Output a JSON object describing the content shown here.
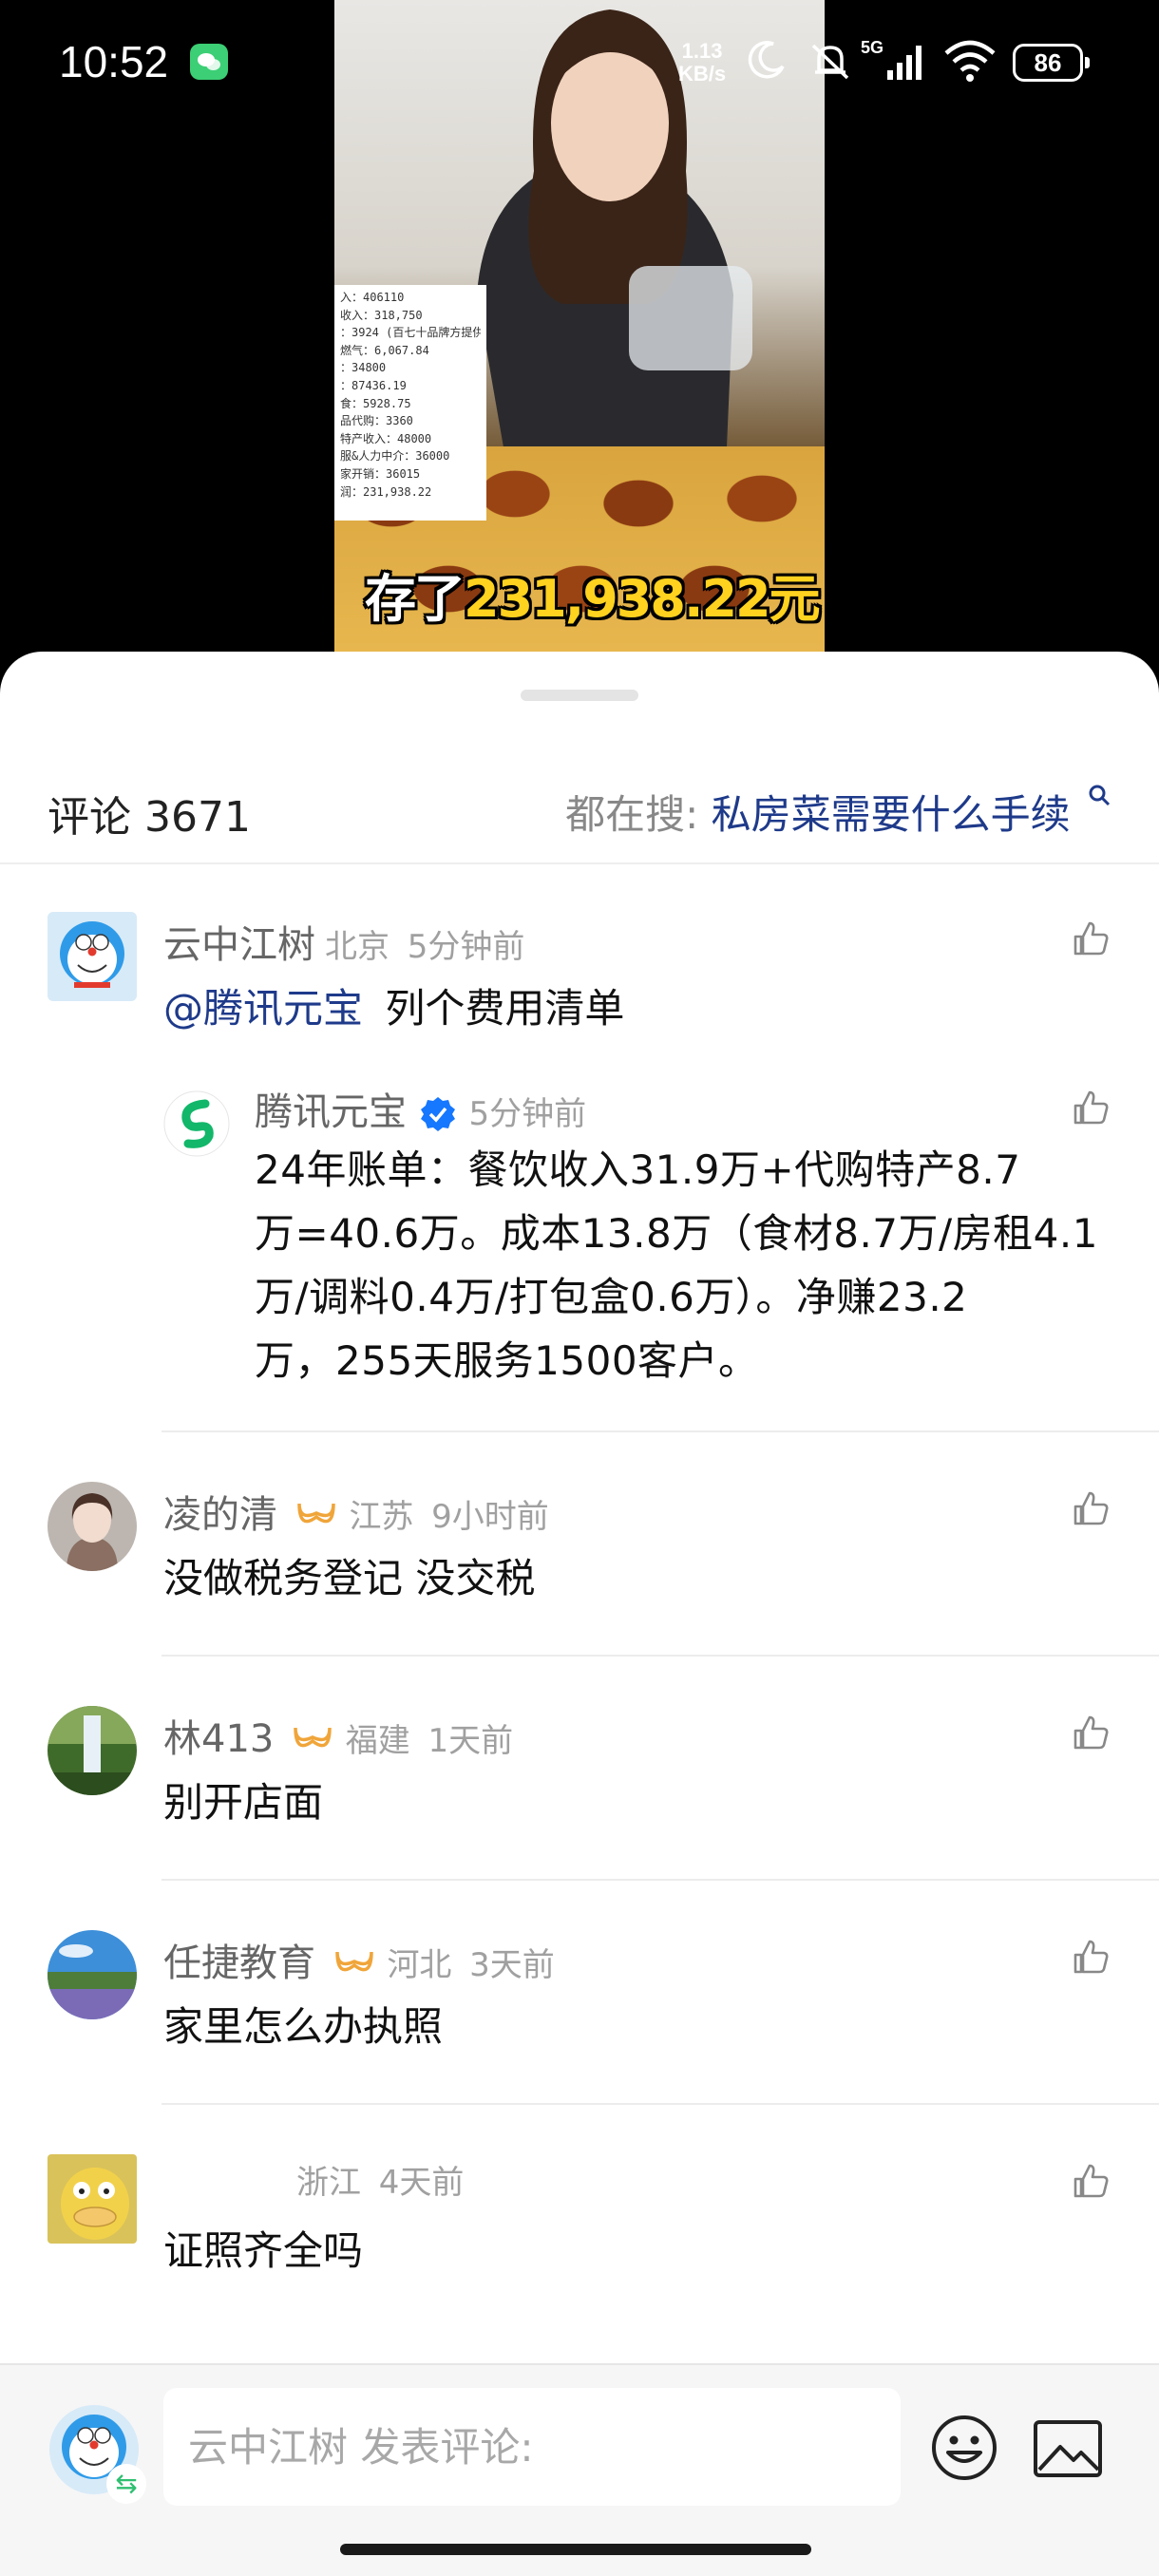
{
  "status_bar": {
    "time": "10:52",
    "net_speed_value": "1.13",
    "net_speed_unit": "KB/s",
    "network": "5G",
    "battery": "86"
  },
  "video": {
    "caption_prefix": "存了",
    "caption_amount": "231,938.22元",
    "receipt_lines": [
      "入：406110",
      "收入：318,750",
      "：3924 (百七十品牌方提供",
      "燃气：6,067.84",
      "：34800",
      "：87436.19",
      "食：5928.75",
      "品代购：3360",
      "特产收入：48000",
      "服&人力中介：36000",
      "家开销：36015",
      "润：231,938.22"
    ]
  },
  "sheet": {
    "title": "评论 3671",
    "search_prefix": "都在搜:",
    "search_term": "私房菜需要什么手续"
  },
  "comments": [
    {
      "name": "云中江树",
      "location": "北京",
      "time": "5分钟前",
      "mention": "@腾讯元宝",
      "text": "列个费用清单",
      "reply": {
        "name": "腾讯元宝",
        "time": "5分钟前",
        "lines": [
          "24年账单：餐饮收入31.9万+代购特产8.7",
          "万=40.6万。成本13.8万（食材8.7万/房租4.1",
          "万/调料0.4万/打包盒0.6万）。净赚23.2",
          "万，255天服务1500客户。"
        ]
      }
    },
    {
      "name": "凌的清",
      "location": "江苏",
      "time": "9小时前",
      "text": "没做税务登记 没交税"
    },
    {
      "name": "林413",
      "location": "福建",
      "time": "1天前",
      "text": "别开店面"
    },
    {
      "name": "任捷教育",
      "location": "河北",
      "time": "3天前",
      "text": "家里怎么办执照"
    },
    {
      "name": "",
      "location": "浙江",
      "time": "4天前",
      "text": "证照齐全吗"
    }
  ],
  "composer": {
    "placeholder": "云中江树 发表评论:"
  },
  "colors": {
    "link": "#1e3a8a",
    "caption_amount": "#ffd21f",
    "verified": "#1677ff",
    "vip_badge": "#f0a53a"
  }
}
